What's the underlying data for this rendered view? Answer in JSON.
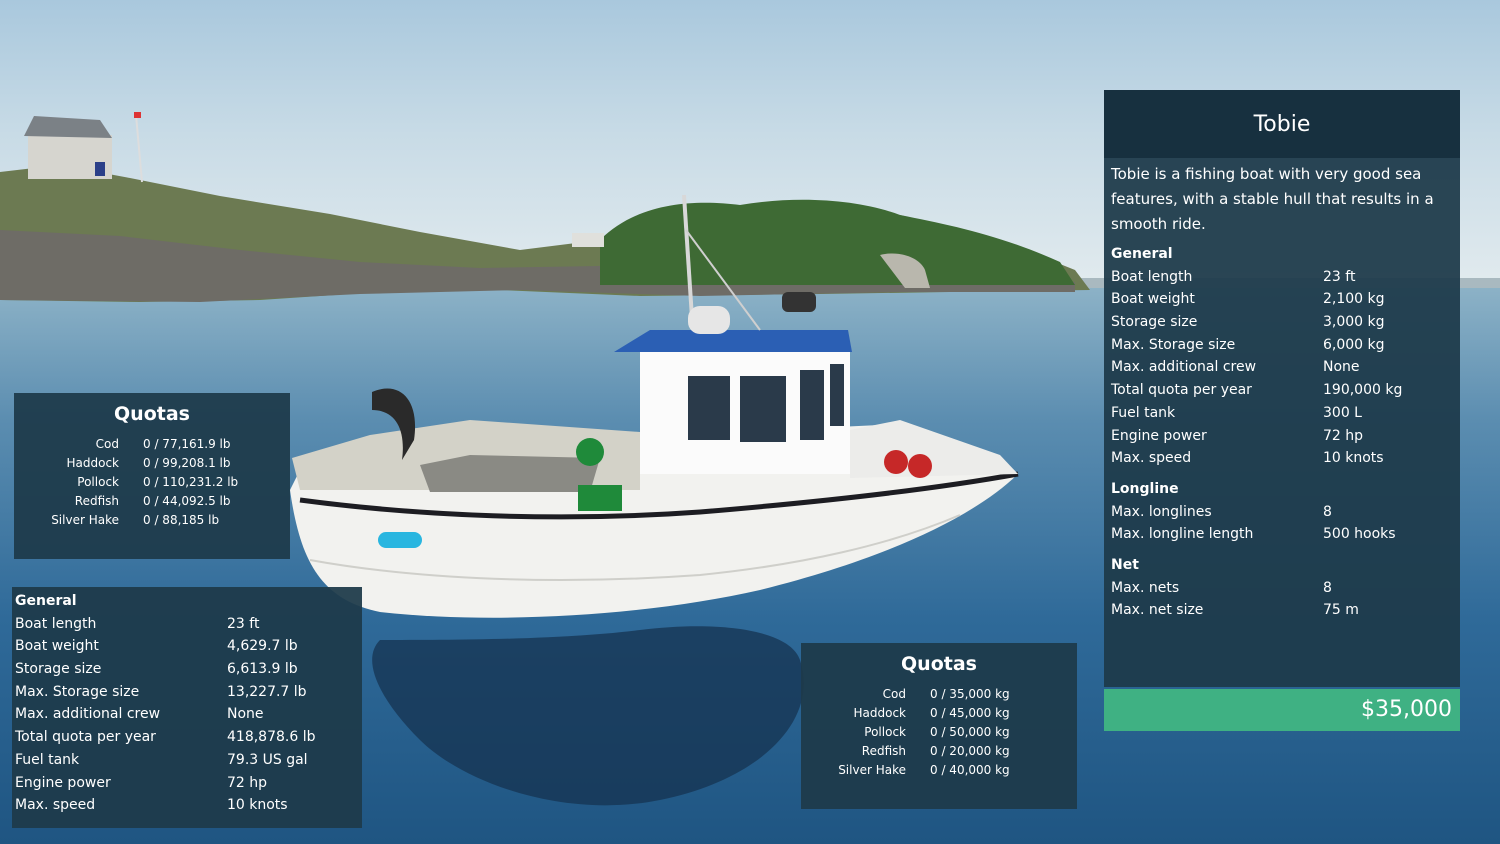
{
  "boat": {
    "name": "Tobie",
    "description": "Tobie is a fishing boat with very good sea features, with a stable hull that results in a smooth ride.",
    "price": "$35,000"
  },
  "detail": {
    "general_heading": "General",
    "general": [
      {
        "label": "Boat length",
        "value": "23 ft"
      },
      {
        "label": "Boat weight",
        "value": "2,100 kg"
      },
      {
        "label": "Storage size",
        "value": "3,000 kg"
      },
      {
        "label": "Max. Storage size",
        "value": "6,000 kg"
      },
      {
        "label": "Max. additional crew",
        "value": "None"
      },
      {
        "label": "Total quota per year",
        "value": "190,000 kg"
      },
      {
        "label": "Fuel tank",
        "value": "300 L"
      },
      {
        "label": "Engine power",
        "value": "72 hp"
      },
      {
        "label": "Max. speed",
        "value": "10 knots"
      }
    ],
    "longline_heading": "Longline",
    "longline": [
      {
        "label": "Max. longlines",
        "value": "8"
      },
      {
        "label": "Max. longline length",
        "value": "500 hooks"
      }
    ],
    "net_heading": "Net",
    "net": [
      {
        "label": "Max. nets",
        "value": "8"
      },
      {
        "label": "Max. net size",
        "value": "75 m"
      }
    ]
  },
  "quotas_imperial": {
    "title": "Quotas",
    "rows": [
      {
        "fish": "Cod",
        "value": "0 / 77,161.9 lb"
      },
      {
        "fish": "Haddock",
        "value": "0 / 99,208.1 lb"
      },
      {
        "fish": "Pollock",
        "value": "0 / 110,231.2 lb"
      },
      {
        "fish": "Redfish",
        "value": "0 / 44,092.5 lb"
      },
      {
        "fish": "Silver Hake",
        "value": "0 / 88,185 lb"
      }
    ]
  },
  "quotas_metric": {
    "title": "Quotas",
    "rows": [
      {
        "fish": "Cod",
        "value": "0 / 35,000 kg"
      },
      {
        "fish": "Haddock",
        "value": "0 / 45,000 kg"
      },
      {
        "fish": "Pollock",
        "value": "0 / 50,000 kg"
      },
      {
        "fish": "Redfish",
        "value": "0 / 20,000 kg"
      },
      {
        "fish": "Silver Hake",
        "value": "0 / 40,000 kg"
      }
    ]
  },
  "general_imperial": {
    "heading": "General",
    "rows": [
      {
        "label": "Boat length",
        "value": "23 ft"
      },
      {
        "label": "Boat weight",
        "value": "4,629.7 lb"
      },
      {
        "label": "Storage size",
        "value": "6,613.9 lb"
      },
      {
        "label": "Max. Storage size",
        "value": "13,227.7 lb"
      },
      {
        "label": "Max. additional crew",
        "value": "None"
      },
      {
        "label": "Total quota per year",
        "value": "418,878.6 lb"
      },
      {
        "label": "Fuel tank",
        "value": "79.3 US gal"
      },
      {
        "label": "Engine power",
        "value": "72 hp"
      },
      {
        "label": "Max. speed",
        "value": "10 knots"
      }
    ]
  }
}
